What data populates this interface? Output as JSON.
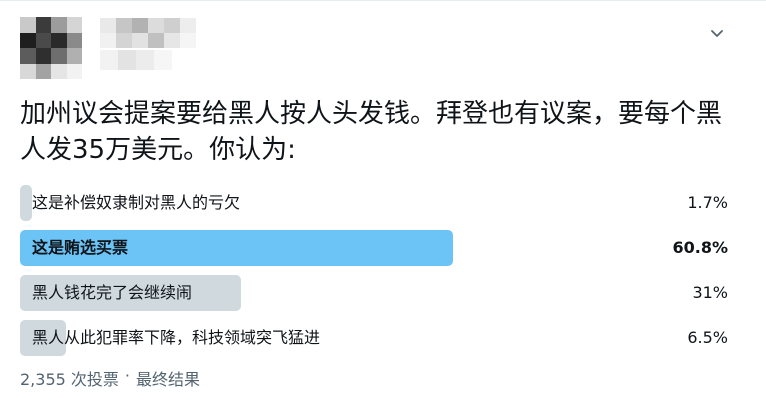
{
  "tweet": {
    "text": "加州议会提案要给黑人按人头发钱。拜登也有议案，要每个黑人发35万美元。你认为:"
  },
  "poll": {
    "options": [
      {
        "label": "这是补偿奴隶制对黑人的亏欠",
        "percent_label": "1.7%",
        "percent": 1.7,
        "winner": false
      },
      {
        "label": "这是贿选买票",
        "percent_label": "60.8%",
        "percent": 60.8,
        "winner": true
      },
      {
        "label": "黑人钱花完了会继续闹",
        "percent_label": "31%",
        "percent": 31,
        "winner": false
      },
      {
        "label": "黑人从此犯罪率下降，科技领域突飞猛进",
        "percent_label": "6.5%",
        "percent": 6.5,
        "winner": false
      }
    ],
    "footer": {
      "votes": "2,355 次投票",
      "separator": "·",
      "status": "最终结果"
    }
  },
  "icons": {
    "menu": "chevron-down-icon"
  },
  "colors": {
    "winner_bar": "#6cc4f6",
    "bar": "#cfd9de",
    "muted_text": "#536471"
  }
}
